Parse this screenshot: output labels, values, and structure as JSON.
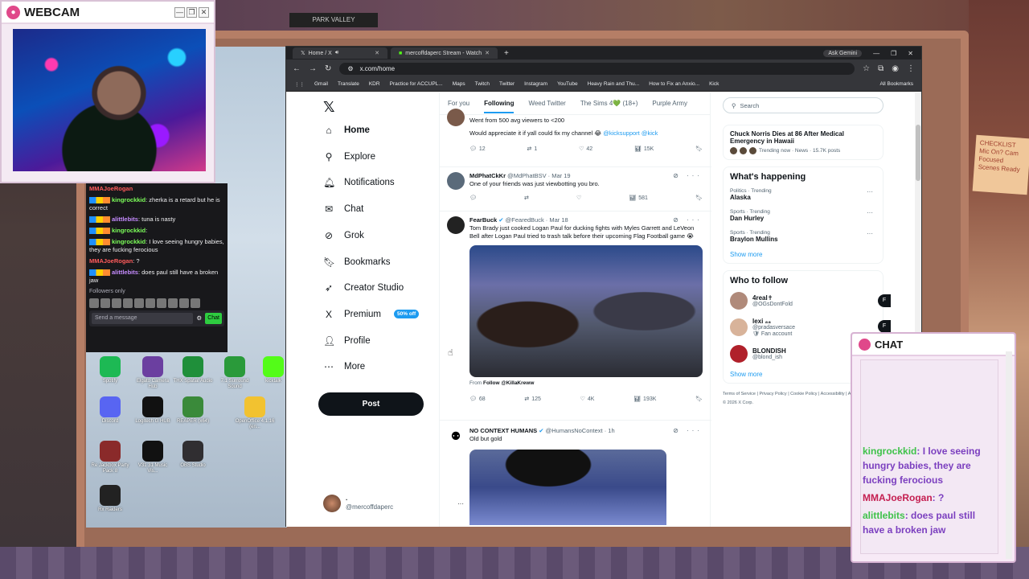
{
  "webcam": {
    "title": "WEBCAM",
    "buttons": [
      "—",
      "❐",
      "✕"
    ]
  },
  "desktop_icons": [
    {
      "label": "Spotify",
      "color": "#1db954"
    },
    {
      "label": "Elgato Camera Hub",
      "color": "#6b3fa0"
    },
    {
      "label": "THX Spatial Audio",
      "color": "#1f8f3a"
    },
    {
      "label": "7.1 Surround Sound",
      "color": "#2a9a3a"
    },
    {
      "label": "kicktalk",
      "color": "#53fc18"
    },
    {
      "label": "Discord",
      "color": "#5865f2"
    },
    {
      "label": "Logitech G HUB",
      "color": "#111111"
    },
    {
      "label": "REAPER (x64)",
      "color": "#3a8a3a"
    },
    {
      "label": "OpenOffice 4.1.16 (en...",
      "color": "#f2c230"
    },
    {
      "label": "Re Jackbox Party Pack 8",
      "color": "#8a2a2a"
    },
    {
      "label": "V31 31 Music Vis...",
      "color": "#111111"
    },
    {
      "label": "OBS Studio",
      "color": "#302e31"
    },
    {
      "label": "Rx Raiders",
      "color": "#222222"
    }
  ],
  "chat_log": {
    "lines": [
      {
        "user": "MMAJoeRogan",
        "text": "",
        "style": "u1"
      },
      {
        "user": "kingrockkid",
        "text": ": zherka is a retard but he is correct",
        "style": "u2"
      },
      {
        "user": "alittlebits",
        "text": ": tuna is nasty",
        "style": "u3"
      },
      {
        "user": "kingrockkid",
        "text": ":",
        "style": "u2"
      },
      {
        "user": "kingrockkid",
        "text": ": I love seeing hungry babies, they are fucking ferocious",
        "style": "u2"
      },
      {
        "user": "MMAJoeRogan",
        "text": ": ?",
        "style": "u1"
      },
      {
        "user": "alittlebits",
        "text": ": does paul still have a broken jaw",
        "style": "u3"
      }
    ],
    "followers_only": "Followers only",
    "send_placeholder": "Send a message",
    "chat_button": "Chat"
  },
  "browser": {
    "tabs": [
      {
        "title": "Home / X",
        "active": true
      },
      {
        "title": "mercoffdaperc Stream - Watch",
        "active": false
      }
    ],
    "ask_gemini": "Ask Gemini",
    "url": "x.com/home",
    "bookmarks": [
      "Gmail",
      "Translate",
      "KDR",
      "Practice for ACCUPL...",
      "Maps",
      "Twitch",
      "Twitter",
      "Instagram",
      "YouTube",
      "Heavy Rain and Thu...",
      "How to Fix an Anxio...",
      "Kick"
    ],
    "all_bookmarks": "All Bookmarks"
  },
  "x_nav": {
    "items": [
      {
        "label": "Home",
        "icon": "home-icon",
        "glyph": "⌂"
      },
      {
        "label": "Explore",
        "icon": "search-icon",
        "glyph": "⚲"
      },
      {
        "label": "Notifications",
        "icon": "bell-icon",
        "glyph": "🔔︎"
      },
      {
        "label": "Chat",
        "icon": "mail-icon",
        "glyph": "✉"
      },
      {
        "label": "Grok",
        "icon": "grok-icon",
        "glyph": "⊘"
      },
      {
        "label": "Bookmarks",
        "icon": "bookmark-icon",
        "glyph": "🔖︎"
      },
      {
        "label": "Creator Studio",
        "icon": "rocket-icon",
        "glyph": "➶"
      },
      {
        "label": "Premium",
        "icon": "x-premium-icon",
        "glyph": "X"
      },
      {
        "label": "Profile",
        "icon": "person-icon",
        "glyph": "👤︎"
      },
      {
        "label": "More",
        "icon": "more-circle-icon",
        "glyph": "⋯"
      }
    ],
    "premium_badge": "50% off",
    "post_button": "Post",
    "account_name": "·",
    "account_handle": "@mercoffdaperc"
  },
  "feed": {
    "tabs": [
      "For you",
      "Following",
      "Weed Twitter",
      "The Sims 4💚 (18+)",
      "Purple Army"
    ],
    "active_tab": "Following",
    "tweets": [
      {
        "text": "Went from 500 avg viewers to <200",
        "text2": "Would appreciate it if yall could fix my channel 😂 ",
        "mentions": "@kicksupport @kick",
        "replies": "12",
        "reposts": "1",
        "likes": "42",
        "views": "15K"
      },
      {
        "name": "MdPhatCkKr",
        "handle": "@MdPhatBSV · Mar 19",
        "text": "One of your friends was just viewbotting you bro.",
        "replies": "",
        "reposts": "",
        "likes": "",
        "views": "581"
      },
      {
        "name": "FearBuck",
        "handle": "@FearedBuck · Mar 18",
        "text": "Tom Brady just cooked Logan Paul for ducking fights with Myles Garrett and LeVeon Bell after Logan Paul tried to trash talk before their upcoming Flag Football game 😭",
        "from_label": "From",
        "from_account": "Follow @KillaKreww",
        "replies": "68",
        "reposts": "125",
        "likes": "4K",
        "views": "193K"
      },
      {
        "name": "NO CONTEXT HUMANS",
        "handle": "@HumansNoContext · 1h",
        "text": "Old but gold"
      }
    ]
  },
  "right_col": {
    "search_placeholder": "Search",
    "top_trend": {
      "title": "Chuck Norris Dies at 86 After Medical Emergency in Hawaii",
      "meta": "Trending now · News · 15.7K posts"
    },
    "whats_happening": "What's happening",
    "trends": [
      {
        "category": "Politics · Trending",
        "name": "Alaska"
      },
      {
        "category": "Sports · Trending",
        "name": "Dan Hurley"
      },
      {
        "category": "Sports · Trending",
        "name": "Braylon Mullins"
      }
    ],
    "show_more": "Show more",
    "who_to_follow": "Who to follow",
    "follows": [
      {
        "name": "4real✝",
        "handle": "@OGsDontFold",
        "note": "",
        "color": "#b08a7a"
      },
      {
        "name": "lexi ₈₈",
        "handle": "@pradasversace",
        "note": "🛡 Fan account",
        "color": "#d8b39a"
      },
      {
        "name": "BLONDISH",
        "handle": "@blond_ish",
        "note": "",
        "color": "#b0202a"
      }
    ],
    "show_more2": "Show more",
    "footer": "Terms of Service  |  Privacy Policy  |  Cookie Policy  |  Accessibility  |  Ads info  |  More ···  © 2026 X Corp."
  },
  "overlay_chat": {
    "title": "CHAT",
    "messages": [
      {
        "user": "kingrockkid",
        "text": ": I love seeing hungry babies, they are fucking ferocious",
        "style": "ou1"
      },
      {
        "user": "MMAJoeRogan",
        "text": ": ?",
        "style": "ou2"
      },
      {
        "user": "alittlebits",
        "text": ": does paul still have a broken jaw",
        "style": "ou3"
      }
    ]
  },
  "room": {
    "sticky_note": "CHECKLIST Mic On? Cam Focused Scenes Ready",
    "shelf_sign": "PARK VALLEY"
  }
}
